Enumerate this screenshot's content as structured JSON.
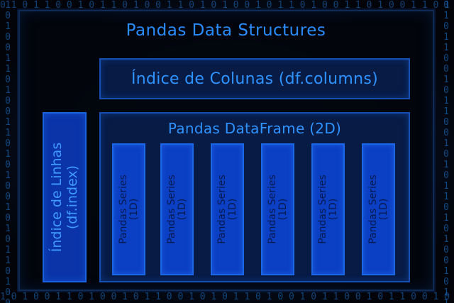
{
  "diagram": {
    "title": "Pandas Data Structures",
    "column_index_label": "Índice de Colunas (df.columns)",
    "row_index_label": {
      "line1": "Índice de Linhas",
      "line2": "(df.index)"
    },
    "dataframe_label": "Pandas DataFrame (2D)",
    "series": [
      {
        "line1": "Pandas Series",
        "line2": "(1D)"
      },
      {
        "line1": "Pandas Series",
        "line2": "(1D)"
      },
      {
        "line1": "Pandas Series",
        "line2": "(1D)"
      },
      {
        "line1": "Pandas Series",
        "line2": "(1D)"
      },
      {
        "line1": "Pandas Series",
        "line2": "(1D)"
      },
      {
        "line1": "Pandas Series",
        "line2": "(1D)"
      }
    ]
  },
  "colors": {
    "accent": "#2a8cff",
    "box_fill": "#071b45",
    "series_fill": "#0b3fc4",
    "background": "#05070d"
  }
}
